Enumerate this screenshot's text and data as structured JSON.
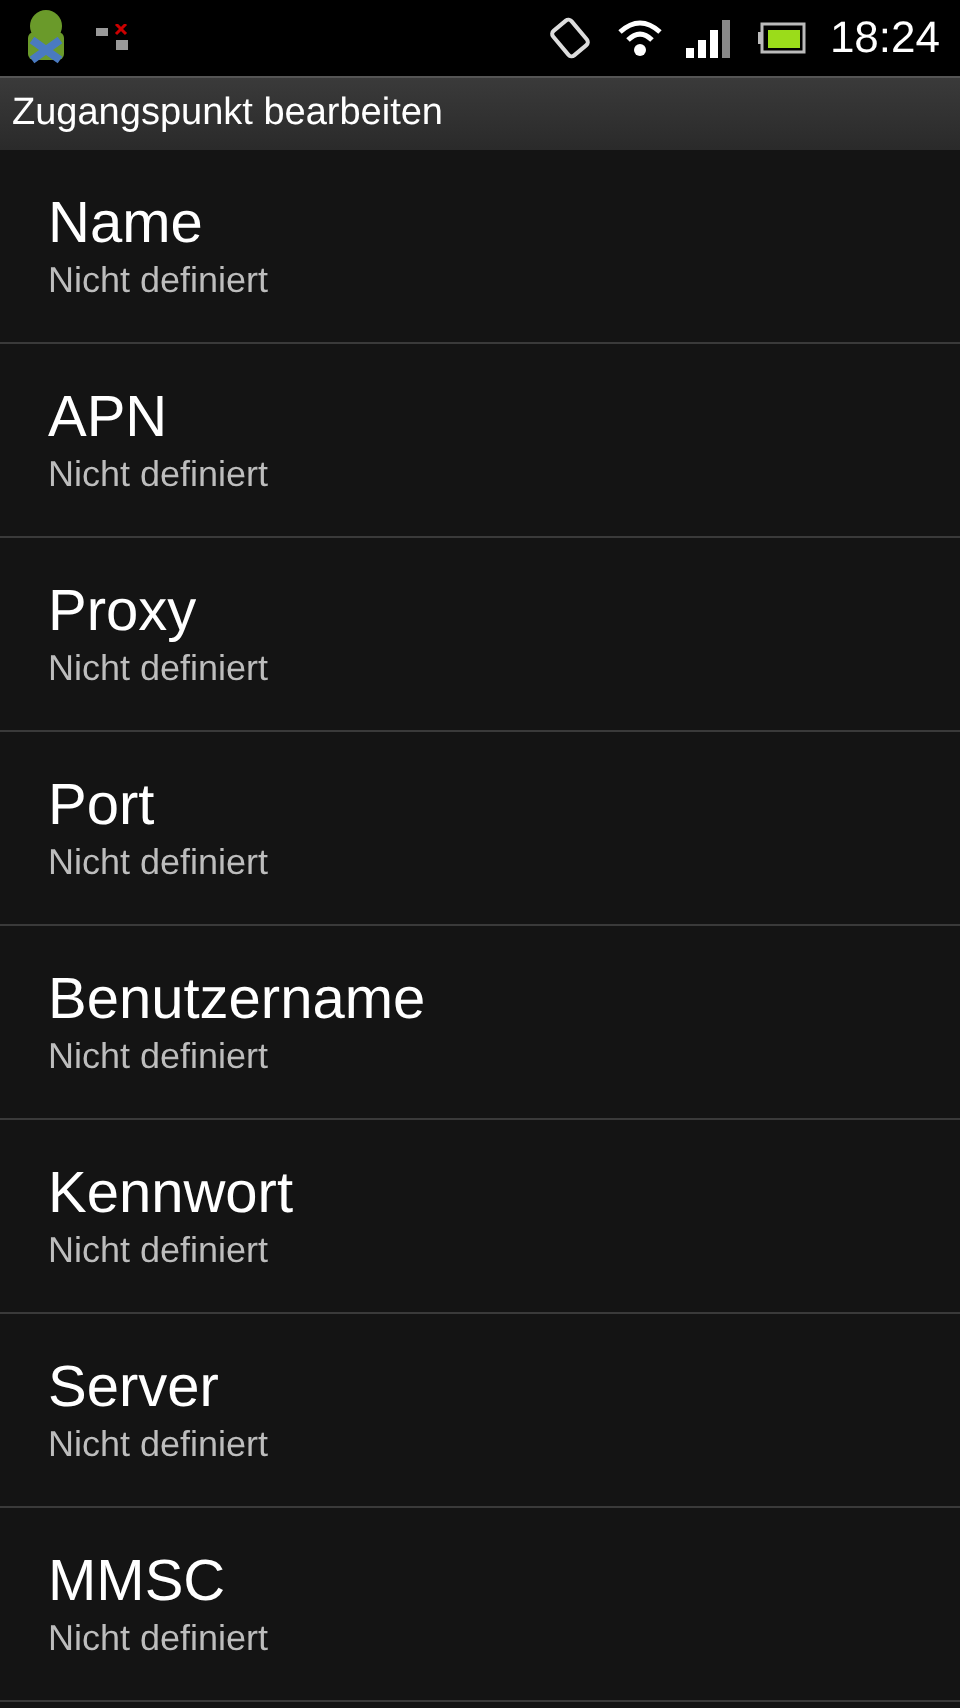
{
  "status_bar": {
    "time": "18:24"
  },
  "window": {
    "title": "Zugangspunkt bearbeiten"
  },
  "settings": [
    {
      "title": "Name",
      "summary": "Nicht definiert"
    },
    {
      "title": "APN",
      "summary": "Nicht definiert"
    },
    {
      "title": "Proxy",
      "summary": "Nicht definiert"
    },
    {
      "title": "Port",
      "summary": "Nicht definiert"
    },
    {
      "title": "Benutzername",
      "summary": "Nicht definiert"
    },
    {
      "title": "Kennwort",
      "summary": "Nicht definiert"
    },
    {
      "title": "Server",
      "summary": "Nicht definiert"
    },
    {
      "title": "MMSC",
      "summary": "Nicht definiert"
    }
  ]
}
